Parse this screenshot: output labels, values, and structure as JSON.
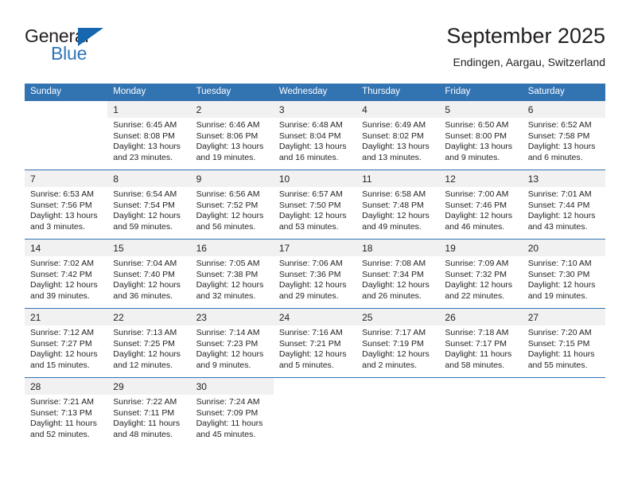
{
  "brand": {
    "name_part1": "General",
    "name_part2": "Blue",
    "logo_color": "#1667b0"
  },
  "header": {
    "title": "September 2025",
    "subtitle": "Endingen, Aargau, Switzerland",
    "accent_color": "#3273b2",
    "daynum_background": "#f1f1f1"
  },
  "calendar": {
    "weekday_headers": [
      "Sunday",
      "Monday",
      "Tuesday",
      "Wednesday",
      "Thursday",
      "Friday",
      "Saturday"
    ],
    "weeks": [
      [
        {
          "day": "",
          "sunrise": "",
          "sunset": "",
          "daylight_line1": "",
          "daylight_line2": ""
        },
        {
          "day": "1",
          "sunrise": "Sunrise: 6:45 AM",
          "sunset": "Sunset: 8:08 PM",
          "daylight_line1": "Daylight: 13 hours",
          "daylight_line2": "and 23 minutes."
        },
        {
          "day": "2",
          "sunrise": "Sunrise: 6:46 AM",
          "sunset": "Sunset: 8:06 PM",
          "daylight_line1": "Daylight: 13 hours",
          "daylight_line2": "and 19 minutes."
        },
        {
          "day": "3",
          "sunrise": "Sunrise: 6:48 AM",
          "sunset": "Sunset: 8:04 PM",
          "daylight_line1": "Daylight: 13 hours",
          "daylight_line2": "and 16 minutes."
        },
        {
          "day": "4",
          "sunrise": "Sunrise: 6:49 AM",
          "sunset": "Sunset: 8:02 PM",
          "daylight_line1": "Daylight: 13 hours",
          "daylight_line2": "and 13 minutes."
        },
        {
          "day": "5",
          "sunrise": "Sunrise: 6:50 AM",
          "sunset": "Sunset: 8:00 PM",
          "daylight_line1": "Daylight: 13 hours",
          "daylight_line2": "and 9 minutes."
        },
        {
          "day": "6",
          "sunrise": "Sunrise: 6:52 AM",
          "sunset": "Sunset: 7:58 PM",
          "daylight_line1": "Daylight: 13 hours",
          "daylight_line2": "and 6 minutes."
        }
      ],
      [
        {
          "day": "7",
          "sunrise": "Sunrise: 6:53 AM",
          "sunset": "Sunset: 7:56 PM",
          "daylight_line1": "Daylight: 13 hours",
          "daylight_line2": "and 3 minutes."
        },
        {
          "day": "8",
          "sunrise": "Sunrise: 6:54 AM",
          "sunset": "Sunset: 7:54 PM",
          "daylight_line1": "Daylight: 12 hours",
          "daylight_line2": "and 59 minutes."
        },
        {
          "day": "9",
          "sunrise": "Sunrise: 6:56 AM",
          "sunset": "Sunset: 7:52 PM",
          "daylight_line1": "Daylight: 12 hours",
          "daylight_line2": "and 56 minutes."
        },
        {
          "day": "10",
          "sunrise": "Sunrise: 6:57 AM",
          "sunset": "Sunset: 7:50 PM",
          "daylight_line1": "Daylight: 12 hours",
          "daylight_line2": "and 53 minutes."
        },
        {
          "day": "11",
          "sunrise": "Sunrise: 6:58 AM",
          "sunset": "Sunset: 7:48 PM",
          "daylight_line1": "Daylight: 12 hours",
          "daylight_line2": "and 49 minutes."
        },
        {
          "day": "12",
          "sunrise": "Sunrise: 7:00 AM",
          "sunset": "Sunset: 7:46 PM",
          "daylight_line1": "Daylight: 12 hours",
          "daylight_line2": "and 46 minutes."
        },
        {
          "day": "13",
          "sunrise": "Sunrise: 7:01 AM",
          "sunset": "Sunset: 7:44 PM",
          "daylight_line1": "Daylight: 12 hours",
          "daylight_line2": "and 43 minutes."
        }
      ],
      [
        {
          "day": "14",
          "sunrise": "Sunrise: 7:02 AM",
          "sunset": "Sunset: 7:42 PM",
          "daylight_line1": "Daylight: 12 hours",
          "daylight_line2": "and 39 minutes."
        },
        {
          "day": "15",
          "sunrise": "Sunrise: 7:04 AM",
          "sunset": "Sunset: 7:40 PM",
          "daylight_line1": "Daylight: 12 hours",
          "daylight_line2": "and 36 minutes."
        },
        {
          "day": "16",
          "sunrise": "Sunrise: 7:05 AM",
          "sunset": "Sunset: 7:38 PM",
          "daylight_line1": "Daylight: 12 hours",
          "daylight_line2": "and 32 minutes."
        },
        {
          "day": "17",
          "sunrise": "Sunrise: 7:06 AM",
          "sunset": "Sunset: 7:36 PM",
          "daylight_line1": "Daylight: 12 hours",
          "daylight_line2": "and 29 minutes."
        },
        {
          "day": "18",
          "sunrise": "Sunrise: 7:08 AM",
          "sunset": "Sunset: 7:34 PM",
          "daylight_line1": "Daylight: 12 hours",
          "daylight_line2": "and 26 minutes."
        },
        {
          "day": "19",
          "sunrise": "Sunrise: 7:09 AM",
          "sunset": "Sunset: 7:32 PM",
          "daylight_line1": "Daylight: 12 hours",
          "daylight_line2": "and 22 minutes."
        },
        {
          "day": "20",
          "sunrise": "Sunrise: 7:10 AM",
          "sunset": "Sunset: 7:30 PM",
          "daylight_line1": "Daylight: 12 hours",
          "daylight_line2": "and 19 minutes."
        }
      ],
      [
        {
          "day": "21",
          "sunrise": "Sunrise: 7:12 AM",
          "sunset": "Sunset: 7:27 PM",
          "daylight_line1": "Daylight: 12 hours",
          "daylight_line2": "and 15 minutes."
        },
        {
          "day": "22",
          "sunrise": "Sunrise: 7:13 AM",
          "sunset": "Sunset: 7:25 PM",
          "daylight_line1": "Daylight: 12 hours",
          "daylight_line2": "and 12 minutes."
        },
        {
          "day": "23",
          "sunrise": "Sunrise: 7:14 AM",
          "sunset": "Sunset: 7:23 PM",
          "daylight_line1": "Daylight: 12 hours",
          "daylight_line2": "and 9 minutes."
        },
        {
          "day": "24",
          "sunrise": "Sunrise: 7:16 AM",
          "sunset": "Sunset: 7:21 PM",
          "daylight_line1": "Daylight: 12 hours",
          "daylight_line2": "and 5 minutes."
        },
        {
          "day": "25",
          "sunrise": "Sunrise: 7:17 AM",
          "sunset": "Sunset: 7:19 PM",
          "daylight_line1": "Daylight: 12 hours",
          "daylight_line2": "and 2 minutes."
        },
        {
          "day": "26",
          "sunrise": "Sunrise: 7:18 AM",
          "sunset": "Sunset: 7:17 PM",
          "daylight_line1": "Daylight: 11 hours",
          "daylight_line2": "and 58 minutes."
        },
        {
          "day": "27",
          "sunrise": "Sunrise: 7:20 AM",
          "sunset": "Sunset: 7:15 PM",
          "daylight_line1": "Daylight: 11 hours",
          "daylight_line2": "and 55 minutes."
        }
      ],
      [
        {
          "day": "28",
          "sunrise": "Sunrise: 7:21 AM",
          "sunset": "Sunset: 7:13 PM",
          "daylight_line1": "Daylight: 11 hours",
          "daylight_line2": "and 52 minutes."
        },
        {
          "day": "29",
          "sunrise": "Sunrise: 7:22 AM",
          "sunset": "Sunset: 7:11 PM",
          "daylight_line1": "Daylight: 11 hours",
          "daylight_line2": "and 48 minutes."
        },
        {
          "day": "30",
          "sunrise": "Sunrise: 7:24 AM",
          "sunset": "Sunset: 7:09 PM",
          "daylight_line1": "Daylight: 11 hours",
          "daylight_line2": "and 45 minutes."
        },
        {
          "day": "",
          "sunrise": "",
          "sunset": "",
          "daylight_line1": "",
          "daylight_line2": ""
        },
        {
          "day": "",
          "sunrise": "",
          "sunset": "",
          "daylight_line1": "",
          "daylight_line2": ""
        },
        {
          "day": "",
          "sunrise": "",
          "sunset": "",
          "daylight_line1": "",
          "daylight_line2": ""
        },
        {
          "day": "",
          "sunrise": "",
          "sunset": "",
          "daylight_line1": "",
          "daylight_line2": ""
        }
      ]
    ]
  }
}
